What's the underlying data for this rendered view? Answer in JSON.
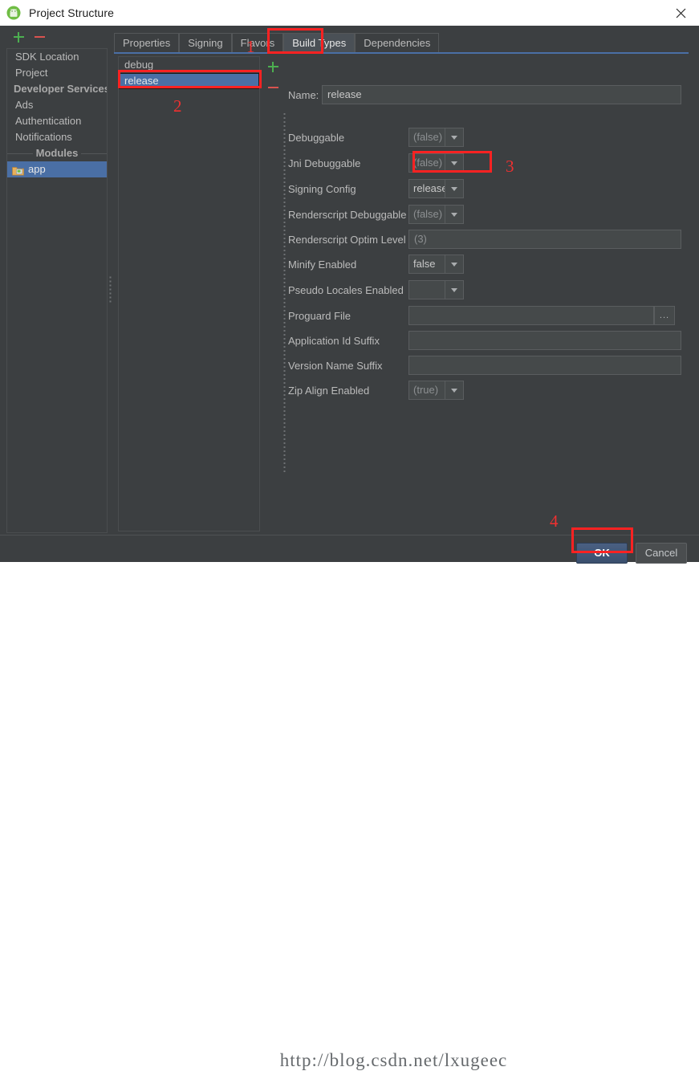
{
  "window": {
    "title": "Project Structure",
    "app_icon": "android-robot-icon",
    "close_icon": "close-icon"
  },
  "toolbar": {
    "add_label": "+",
    "remove_label": "−"
  },
  "sidebar": {
    "items": [
      {
        "label": "SDK Location",
        "type": "item",
        "selected": false
      },
      {
        "label": "Project",
        "type": "item",
        "selected": false
      },
      {
        "label": "Developer Services",
        "type": "group-left",
        "selected": false
      },
      {
        "label": "Ads",
        "type": "item",
        "selected": false
      },
      {
        "label": "Authentication",
        "type": "item",
        "selected": false
      },
      {
        "label": "Notifications",
        "type": "item",
        "selected": false
      },
      {
        "label": "Modules",
        "type": "group-center",
        "selected": false
      },
      {
        "label": "app",
        "type": "module",
        "selected": true,
        "icon": "module-folder-icon"
      }
    ]
  },
  "tabs": [
    {
      "label": "Properties",
      "active": false
    },
    {
      "label": "Signing",
      "active": false
    },
    {
      "label": "Flavors",
      "active": false
    },
    {
      "label": "Build Types",
      "active": true
    },
    {
      "label": "Dependencies",
      "active": false
    }
  ],
  "build_types": {
    "items": [
      {
        "label": "debug",
        "selected": false
      },
      {
        "label": "release",
        "selected": true
      }
    ],
    "add_label": "+",
    "remove_label": "−"
  },
  "form": {
    "name_label": "Name:",
    "name_value": "release",
    "rows": [
      {
        "label": "Debuggable",
        "kind": "combo",
        "value": "(false)",
        "dim": true
      },
      {
        "label": "Jni Debuggable",
        "kind": "combo",
        "value": "(false)",
        "dim": true
      },
      {
        "label": "Signing Config",
        "kind": "combo",
        "value": "release",
        "dim": false
      },
      {
        "label": "Renderscript Debuggable",
        "kind": "combo",
        "value": "(false)",
        "dim": true
      },
      {
        "label": "Renderscript Optim Level",
        "kind": "text",
        "value": "(3)",
        "dim": true
      },
      {
        "label": "Minify Enabled",
        "kind": "combo",
        "value": "false",
        "dim": false
      },
      {
        "label": "Pseudo Locales Enabled",
        "kind": "combo",
        "value": "",
        "dim": true
      },
      {
        "label": "Proguard File",
        "kind": "browse",
        "value": "",
        "dim": true,
        "browse_label": "..."
      },
      {
        "label": "Application Id Suffix",
        "kind": "text",
        "value": "",
        "dim": true
      },
      {
        "label": "Version Name Suffix",
        "kind": "text",
        "value": "",
        "dim": true
      },
      {
        "label": "Zip Align Enabled",
        "kind": "combo",
        "value": "(true)",
        "dim": true
      }
    ]
  },
  "dialog_buttons": {
    "ok_label": "OK",
    "cancel_label": "Cancel"
  },
  "watermark": {
    "text": "http://blog.csdn.net/lxugeec"
  },
  "annotations": [
    {
      "number": "1"
    },
    {
      "number": "2"
    },
    {
      "number": "3"
    },
    {
      "number": "4"
    }
  ]
}
